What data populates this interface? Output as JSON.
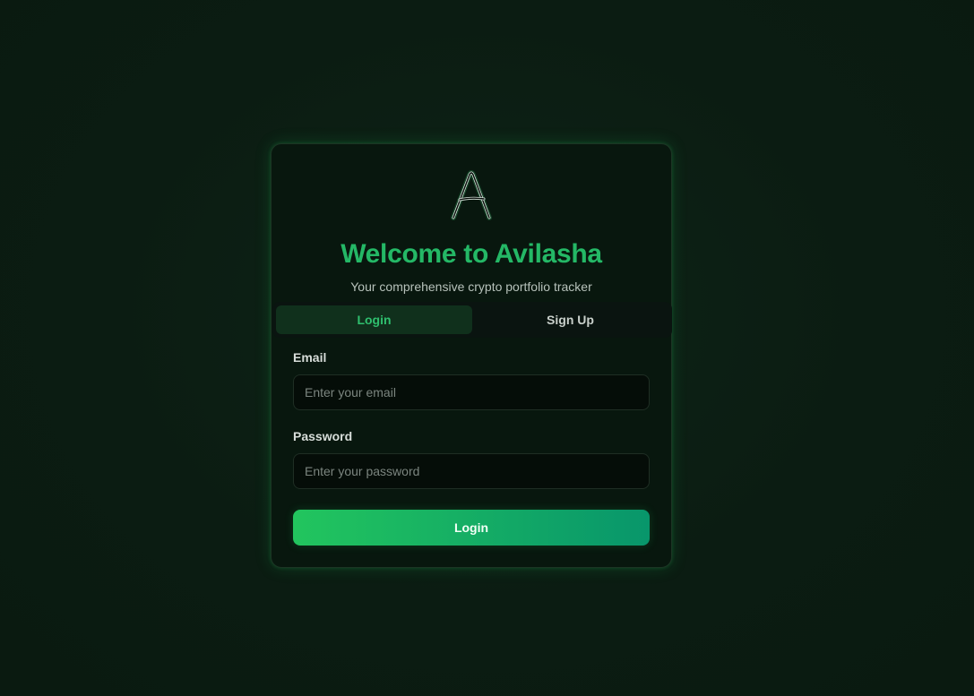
{
  "app": {
    "title": "Welcome to Avilasha",
    "subtitle": "Your comprehensive crypto portfolio tracker",
    "logo_letter": "A",
    "logo_icon": "avilasha-logo-icon"
  },
  "tabs": [
    {
      "label": "Login",
      "active": true
    },
    {
      "label": "Sign Up",
      "active": false
    }
  ],
  "form": {
    "email_label": "Email",
    "email_placeholder": "Enter your email",
    "email_value": "",
    "password_label": "Password",
    "password_placeholder": "Enter your password",
    "password_value": "",
    "submit_label": "Login"
  },
  "colors": {
    "accent": "#24b866",
    "background": "#0b1d13",
    "button_gradient_start": "#22c55e",
    "button_gradient_end": "#08966b"
  }
}
